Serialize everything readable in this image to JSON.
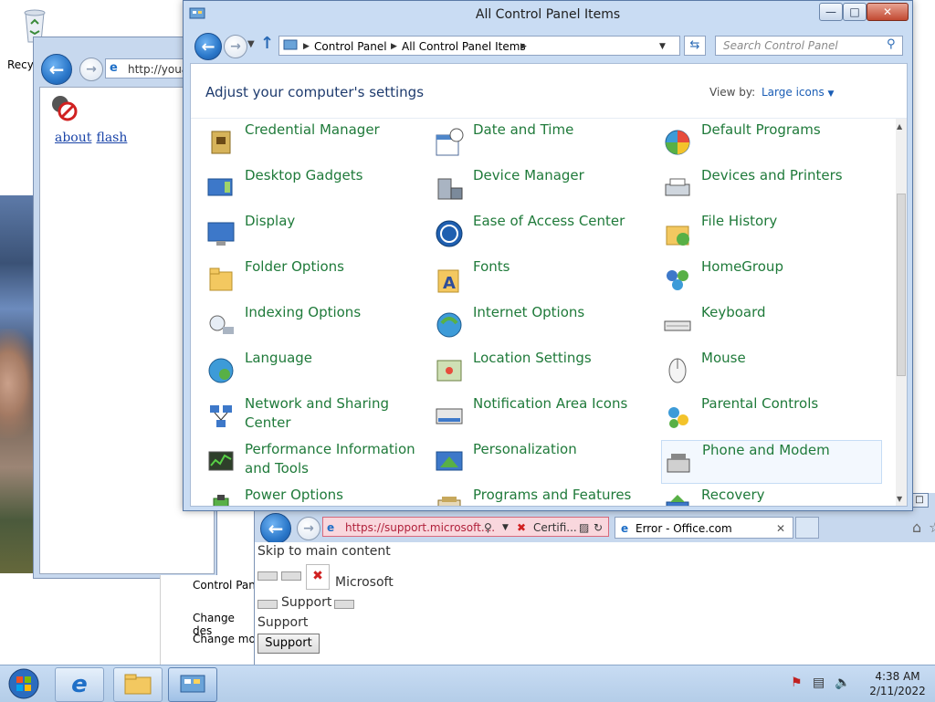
{
  "desktop": {
    "recycle_label": "Recyc"
  },
  "ie_back": {
    "address": "http://youa",
    "links": [
      "about",
      "flash"
    ]
  },
  "ie_bottom": {
    "address": "https://support.microsoft....",
    "cert_label": "Certifi...",
    "tab_title": "Error - Office.com",
    "skip_link": "Skip to main content",
    "brand": "Microsoft",
    "nav_support": "Support",
    "support_heading": "Support",
    "support_button": "Support"
  },
  "explorer_fragment": {
    "items": [
      "Control Pan",
      "Change des",
      "Change mo"
    ]
  },
  "control_panel": {
    "title": "All Control Panel Items",
    "breadcrumb": [
      "Control Panel",
      "All Control Panel Items"
    ],
    "search_placeholder": "Search Control Panel",
    "header": "Adjust your computer's settings",
    "view_by_label": "View by:",
    "view_by_value": "Large icons",
    "items": [
      {
        "label": "Credential Manager",
        "icon": "credential-manager-icon"
      },
      {
        "label": "Date and Time",
        "icon": "date-time-icon"
      },
      {
        "label": "Default Programs",
        "icon": "default-programs-icon"
      },
      {
        "label": "Desktop Gadgets",
        "icon": "desktop-gadgets-icon"
      },
      {
        "label": "Device Manager",
        "icon": "device-manager-icon"
      },
      {
        "label": "Devices and Printers",
        "icon": "devices-printers-icon"
      },
      {
        "label": "Display",
        "icon": "display-icon"
      },
      {
        "label": "Ease of Access Center",
        "icon": "ease-of-access-icon"
      },
      {
        "label": "File History",
        "icon": "file-history-icon"
      },
      {
        "label": "Folder Options",
        "icon": "folder-options-icon"
      },
      {
        "label": "Fonts",
        "icon": "fonts-icon"
      },
      {
        "label": "HomeGroup",
        "icon": "homegroup-icon"
      },
      {
        "label": "Indexing Options",
        "icon": "indexing-options-icon"
      },
      {
        "label": "Internet Options",
        "icon": "internet-options-icon"
      },
      {
        "label": "Keyboard",
        "icon": "keyboard-icon"
      },
      {
        "label": "Language",
        "icon": "language-icon"
      },
      {
        "label": "Location Settings",
        "icon": "location-settings-icon"
      },
      {
        "label": "Mouse",
        "icon": "mouse-icon"
      },
      {
        "label": "Network and Sharing Center",
        "icon": "network-sharing-icon"
      },
      {
        "label": "Notification Area Icons",
        "icon": "notification-area-icon"
      },
      {
        "label": "Parental Controls",
        "icon": "parental-controls-icon"
      },
      {
        "label": "Performance Information and Tools",
        "icon": "performance-icon"
      },
      {
        "label": "Personalization",
        "icon": "personalization-icon"
      },
      {
        "label": "Phone and Modem",
        "icon": "phone-modem-icon"
      },
      {
        "label": "Power Options",
        "icon": "power-options-icon"
      },
      {
        "label": "Programs and Features",
        "icon": "programs-features-icon"
      },
      {
        "label": "Recovery",
        "icon": "recovery-icon"
      }
    ]
  },
  "taskbar": {
    "time": "4:38 AM",
    "date": "2/11/2022"
  },
  "colors": {
    "item_text": "#1f7a3a",
    "header_text": "#1e3b6e",
    "link_blue": "#1a5db5"
  }
}
